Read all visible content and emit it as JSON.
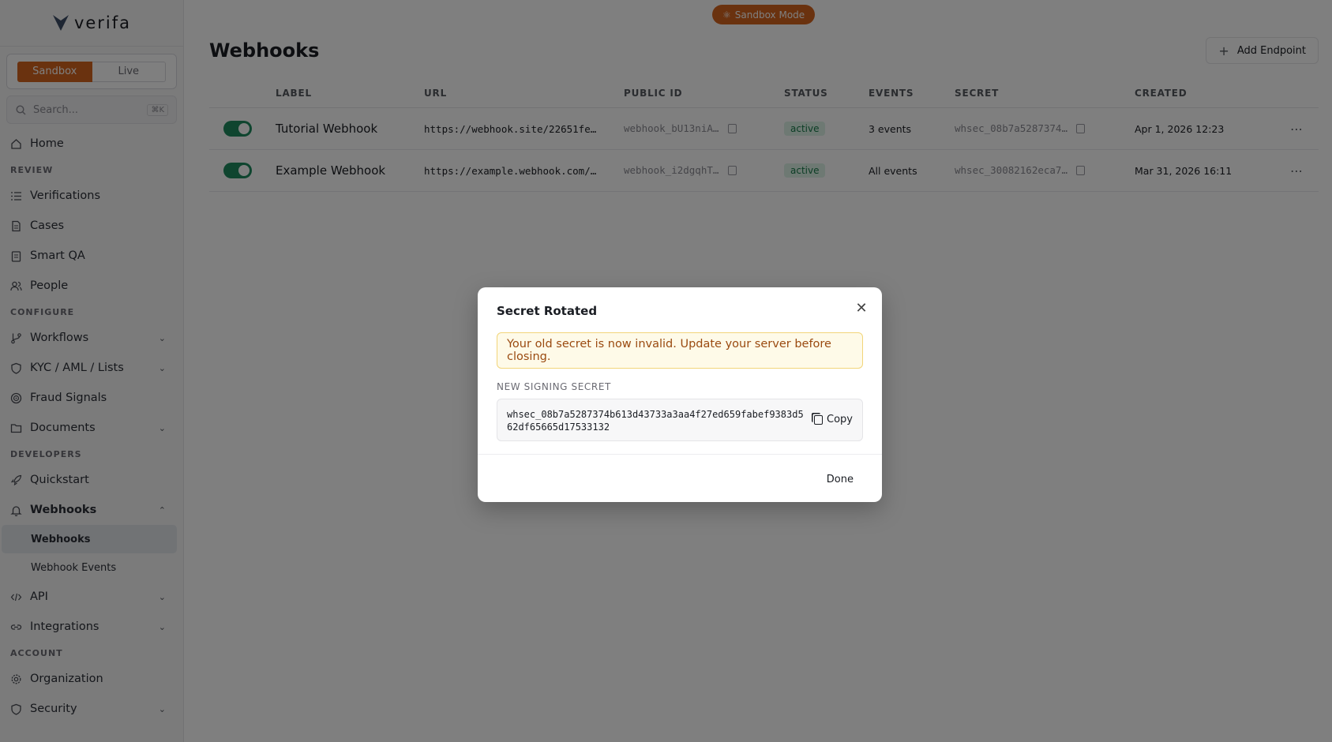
{
  "brand": {
    "name": "verifa"
  },
  "env_toggle": {
    "sandbox": "Sandbox",
    "live": "Live"
  },
  "search": {
    "placeholder": "Search...",
    "shortcut": "⌘K"
  },
  "nav": {
    "home": "Home",
    "review_header": "REVIEW",
    "verifications": "Verifications",
    "cases": "Cases",
    "smart_qa": "Smart QA",
    "people": "People",
    "configure_header": "CONFIGURE",
    "workflows": "Workflows",
    "kyc": "KYC / AML / Lists",
    "fraud_signals": "Fraud Signals",
    "documents": "Documents",
    "developers_header": "DEVELOPERS",
    "quickstart": "Quickstart",
    "webhooks": "Webhooks",
    "webhooks_sub": "Webhooks",
    "webhook_events": "Webhook Events",
    "api": "API",
    "integrations": "Integrations",
    "account_header": "ACCOUNT",
    "organization": "Organization",
    "security": "Security"
  },
  "header": {
    "sandbox_mode": "Sandbox Mode",
    "title": "Webhooks",
    "add_endpoint": "Add Endpoint"
  },
  "table": {
    "columns": [
      "LABEL",
      "URL",
      "PUBLIC ID",
      "STATUS",
      "EVENTS",
      "SECRET",
      "CREATED"
    ],
    "rows": [
      {
        "label": "Tutorial Webhook",
        "url": "https://webhook.site/22651fe…",
        "public_id": "webhook_bU13niA…",
        "status": "active",
        "events": "3 events",
        "secret": "whsec_08b7a5287374…",
        "created": "Apr 1, 2026 12:23"
      },
      {
        "label": "Example Webhook",
        "url": "https://example.webhook.com/…",
        "public_id": "webhook_i2dgqhT…",
        "status": "active",
        "events": "All events",
        "secret": "whsec_30082162eca7…",
        "created": "Mar 31, 2026 16:11"
      }
    ]
  },
  "modal": {
    "title": "Secret Rotated",
    "warning": "Your old secret is now invalid. Update your server before closing.",
    "secret_label": "NEW SIGNING SECRET",
    "secret_value": "whsec_08b7a5287374b613d43733a3aa4f27ed659fabef9383d562df65665d17533132",
    "copy": "Copy",
    "done": "Done"
  },
  "colors": {
    "accent": "#d5641f",
    "toggle_on": "#1e8a5f",
    "status_active_bg": "#dcf3e6",
    "warning_bg": "#fefae8"
  }
}
